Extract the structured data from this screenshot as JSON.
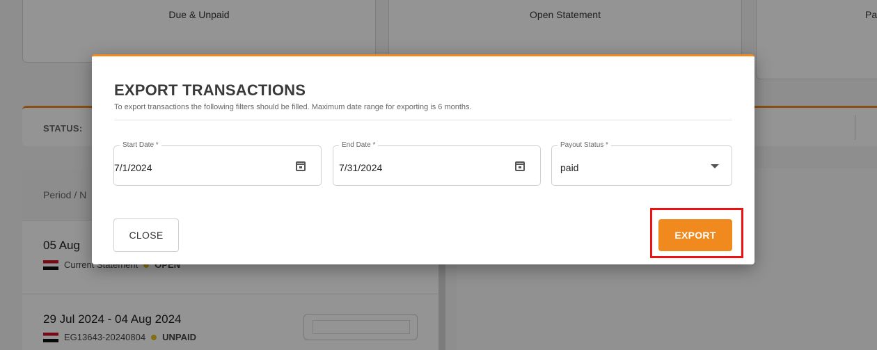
{
  "summary_cards": [
    {
      "label": "Due & Unpaid"
    },
    {
      "label": "Open Statement"
    },
    {
      "label": "Pa"
    }
  ],
  "filter_bar": {
    "label": "STATUS:"
  },
  "list": {
    "header": "Period / N",
    "rows": [
      {
        "title": "05 Aug",
        "subtitle": "Current Statement",
        "status": "OPEN"
      },
      {
        "title": "29 Jul 2024 - 04 Aug 2024",
        "subtitle": "EG13643-20240804",
        "status": "UNPAID"
      }
    ]
  },
  "dialog": {
    "title": "EXPORT TRANSACTIONS",
    "subtitle": "To export transactions the following filters should be filled. Maximum date range for exporting is 6 months.",
    "fields": [
      {
        "label": "Start Date *",
        "value": "7/1/2024",
        "icon": "calendar-icon"
      },
      {
        "label": "End Date *",
        "value": "7/31/2024",
        "icon": "calendar-icon"
      },
      {
        "label": "Payout Status *",
        "value": "paid",
        "icon": "chevron-down-icon"
      }
    ],
    "close_label": "CLOSE",
    "export_label": "EXPORT"
  },
  "colors": {
    "accent": "#f08a1e",
    "highlight": "#ee1111"
  }
}
